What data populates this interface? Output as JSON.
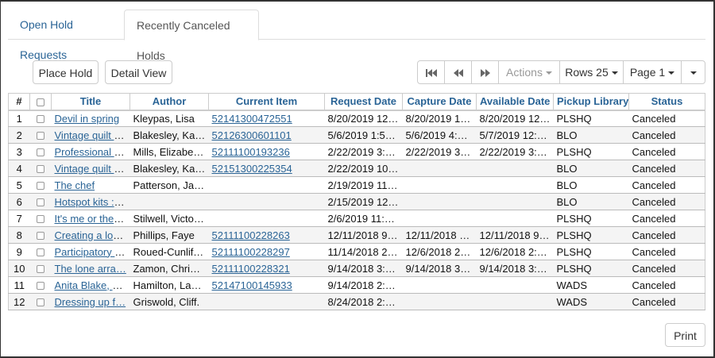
{
  "tabs": [
    {
      "label": "Open Hold Requests"
    },
    {
      "label": "Recently Canceled Holds"
    }
  ],
  "toolbar": {
    "place_hold": "Place Hold",
    "detail_view": "Detail View",
    "actions": "Actions",
    "rows": "Rows 25",
    "page": "Page 1"
  },
  "columns": [
    "#",
    "",
    "Title",
    "Author",
    "Current Item",
    "Request Date",
    "Capture Date",
    "Available Date",
    "Pickup Library",
    "Status"
  ],
  "rows": [
    {
      "n": "1",
      "title": "Devil in spring",
      "author": "Kleypas, Lisa",
      "item": "52141300472551",
      "request": "8/20/2019 12:…",
      "capture": "8/20/2019 12:…",
      "available": "8/20/2019 12:…",
      "lib": "PLSHQ",
      "status": "Canceled"
    },
    {
      "n": "2",
      "title": "Vintage quilt r…",
      "author": "Blakesley, Kat…",
      "item": "52126300601101",
      "request": "5/6/2019 1:56…",
      "capture": "5/6/2019 4:20…",
      "available": "5/7/2019 12:3…",
      "lib": "BLO",
      "status": "Canceled"
    },
    {
      "n": "3",
      "title": "Professional g…",
      "author": "Mills, Elizabet…",
      "item": "52111100193236",
      "request": "2/22/2019 3:1…",
      "capture": "2/22/2019 3:1…",
      "available": "2/22/2019 3:1…",
      "lib": "PLSHQ",
      "status": "Canceled"
    },
    {
      "n": "4",
      "title": "Vintage quilt r…",
      "author": "Blakesley, Kat…",
      "item": "52151300225354",
      "request": "2/22/2019 10:…",
      "capture": "",
      "available": "",
      "lib": "BLO",
      "status": "Canceled"
    },
    {
      "n": "5",
      "title": "The chef",
      "author": "Patterson, Ja…",
      "item": "",
      "request": "2/19/2019 11:…",
      "capture": "",
      "available": "",
      "lib": "BLO",
      "status": "Canceled"
    },
    {
      "n": "6",
      "title": "Hotspot kits : […",
      "author": "",
      "item": "",
      "request": "2/15/2019 12:…",
      "capture": "",
      "available": "",
      "lib": "BLO",
      "status": "Canceled"
    },
    {
      "n": "7",
      "title": "It's me or the …",
      "author": "Stilwell, Victor…",
      "item": "",
      "request": "2/6/2019 11:2…",
      "capture": "",
      "available": "",
      "lib": "PLSHQ",
      "status": "Canceled"
    },
    {
      "n": "8",
      "title": "Creating a loc…",
      "author": "Phillips, Faye",
      "item": "52111100228263",
      "request": "12/11/2018 9:…",
      "capture": "12/11/2018 9:…",
      "available": "12/11/2018 9:…",
      "lib": "PLSHQ",
      "status": "Canceled"
    },
    {
      "n": "9",
      "title": "Participatory h…",
      "author": "Roued-Cunliff…",
      "item": "52111100228297",
      "request": "11/14/2018 2:…",
      "capture": "12/6/2018 2:1…",
      "available": "12/6/2018 2:2…",
      "lib": "PLSHQ",
      "status": "Canceled"
    },
    {
      "n": "10",
      "title": "The lone arra…",
      "author": "Zamon, Christ…",
      "item": "52111100228321",
      "request": "9/14/2018 3:4…",
      "capture": "9/14/2018 3:4…",
      "available": "9/14/2018 3:4…",
      "lib": "PLSHQ",
      "status": "Canceled"
    },
    {
      "n": "11",
      "title": "Anita Blake, v…",
      "author": "Hamilton, Lau…",
      "item": "52147100145933",
      "request": "9/14/2018 2:2…",
      "capture": "",
      "available": "",
      "lib": "WADS",
      "status": "Canceled"
    },
    {
      "n": "12",
      "title": "Dressing up f…",
      "author": "Griswold, Cliff.",
      "item": "",
      "request": "8/24/2018 2:4…",
      "capture": "",
      "available": "",
      "lib": "WADS",
      "status": "Canceled"
    }
  ],
  "footer": {
    "print": "Print"
  }
}
